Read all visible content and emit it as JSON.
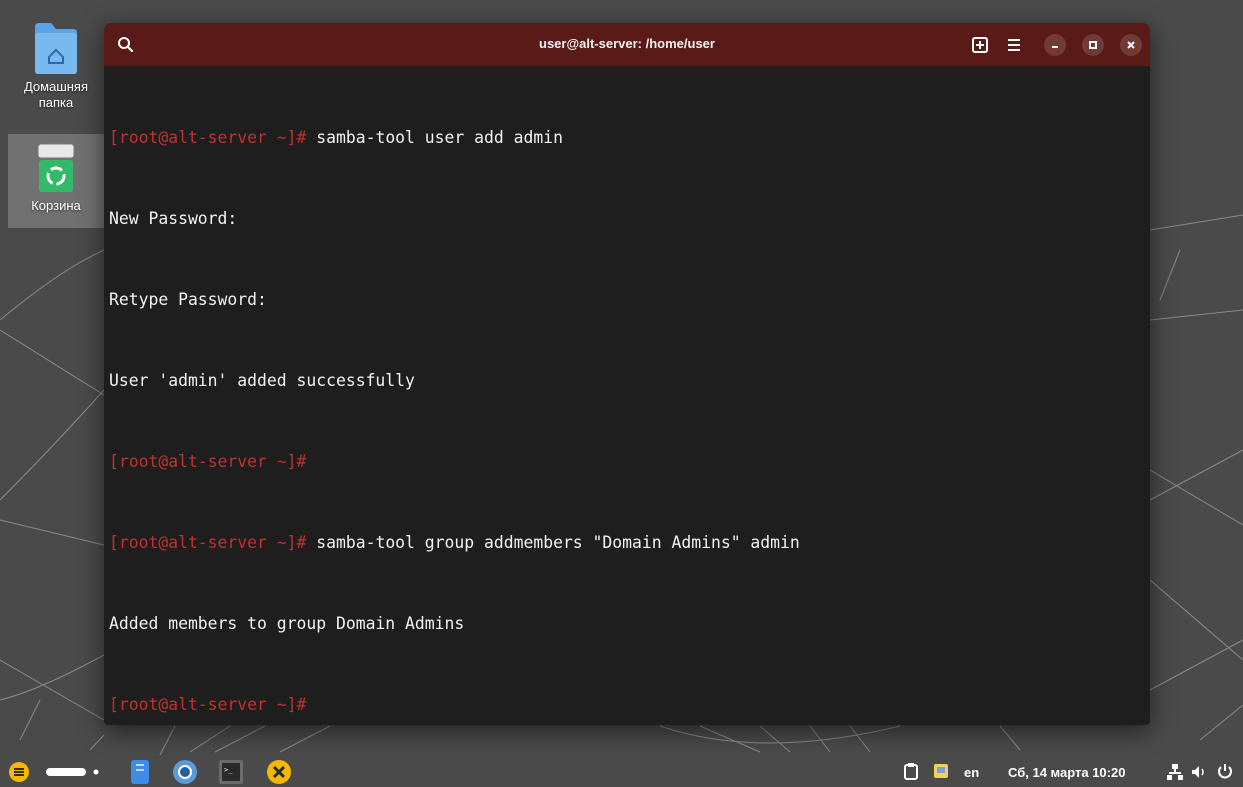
{
  "desktop": {
    "icons": [
      {
        "label": "Домашняя\nпапка"
      },
      {
        "label": "Корзина"
      }
    ]
  },
  "terminal": {
    "title": "user@alt-server: /home/user",
    "prompt": "[root@alt-server ~]#",
    "lines": [
      {
        "prompt": true,
        "text": " samba-tool user add admin"
      },
      {
        "prompt": false,
        "text": "New Password:"
      },
      {
        "prompt": false,
        "text": "Retype Password:"
      },
      {
        "prompt": false,
        "text": "User 'admin' added successfully"
      },
      {
        "prompt": true,
        "text": ""
      },
      {
        "prompt": true,
        "text": " samba-tool group addmembers \"Domain Admins\" admin"
      },
      {
        "prompt": false,
        "text": "Added members to group Domain Admins"
      },
      {
        "prompt": true,
        "text": ""
      }
    ]
  },
  "taskbar": {
    "keyboard_layout": "en",
    "datetime": "Сб, 14 марта 10:20"
  },
  "colors": {
    "headerbar": "#5a1a17",
    "terminal_bg": "#1e1e1e",
    "prompt": "#c0312f",
    "accent_yellow": "#f5b800"
  }
}
